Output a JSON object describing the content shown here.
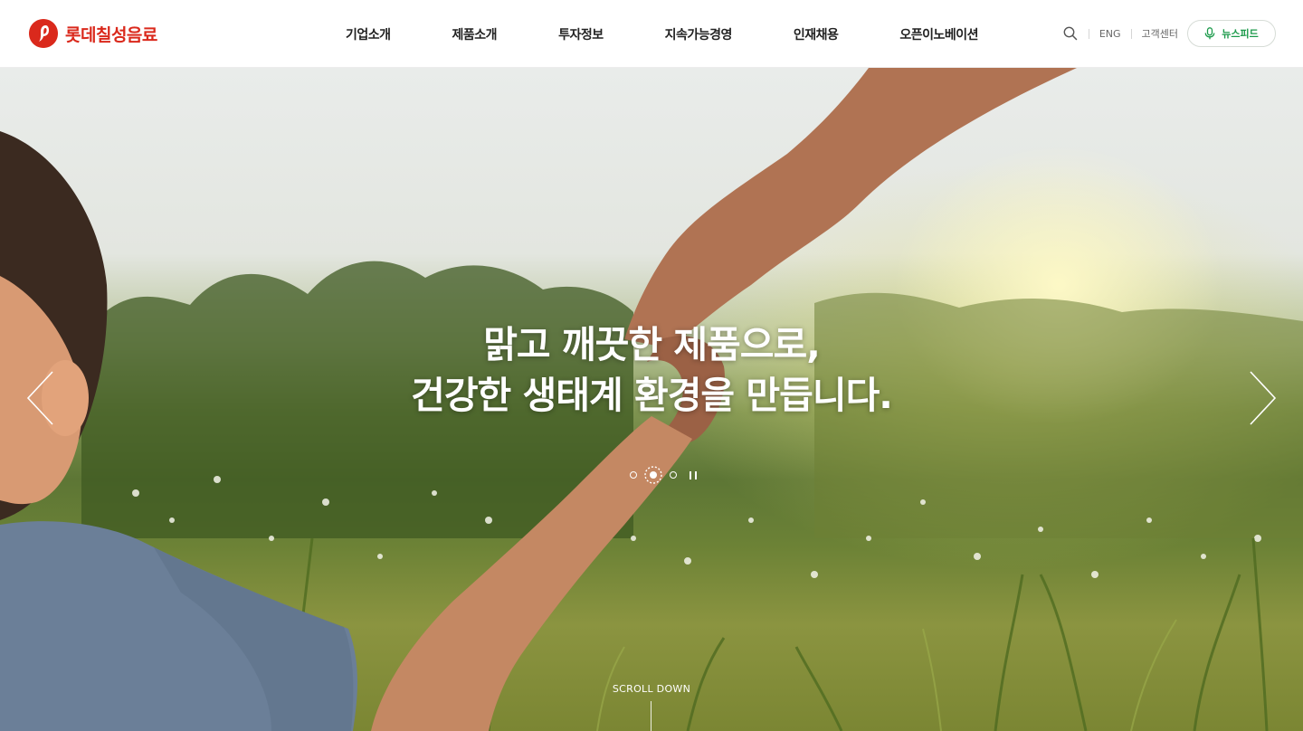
{
  "brand": {
    "name": "롯데칠성음료",
    "color": "#da291c"
  },
  "nav": {
    "items": [
      "기업소개",
      "제품소개",
      "투자정보",
      "지속가능경영",
      "인재채용",
      "오픈이노베이션"
    ]
  },
  "utility": {
    "search_icon": "search-icon",
    "lang": "ENG",
    "support": "고객센터",
    "newsfeed": "뉴스피드",
    "newsfeed_icon": "microphone-icon",
    "newsfeed_color": "#1b9a4a"
  },
  "hero": {
    "headline_line1": "맑고 깨끗한 제품으로,",
    "headline_line2": "건강한 생태계 환경을 만듭니다.",
    "slide_count": 3,
    "active_slide": 2,
    "scroll_label": "SCROLL DOWN"
  }
}
